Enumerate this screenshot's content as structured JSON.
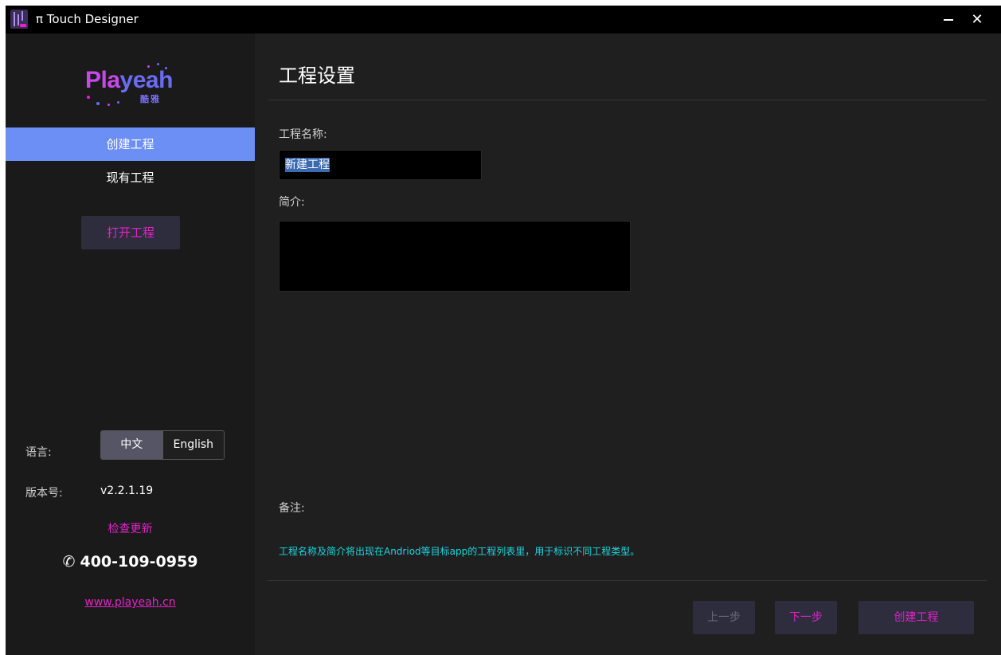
{
  "window": {
    "title": "π Touch Designer",
    "minimize_label": "minimize",
    "close_glyph": "✕"
  },
  "sidebar": {
    "logo": {
      "word_a": "Pla",
      "word_b": "yeah",
      "sub": "酷雅"
    },
    "nav": [
      {
        "label": "创建工程",
        "active": true
      },
      {
        "label": "现有工程",
        "active": false
      }
    ],
    "open_project_label": "打开工程",
    "language": {
      "label": "语言:",
      "options": [
        "中文",
        "English"
      ],
      "selected": "中文"
    },
    "version": {
      "label": "版本号:",
      "value": "v2.2.1.19"
    },
    "check_update_label": "检查更新",
    "phone": {
      "icon": "phone-icon",
      "glyph": "✆",
      "number": "400-109-0959"
    },
    "website": "www.playeah.cn"
  },
  "main": {
    "title": "工程设置",
    "name_label": "工程名称:",
    "name_value": "新建工程",
    "desc_label": "简介:",
    "desc_value": "",
    "note_label": "备注:",
    "note_text": "工程名称及简介将出现在Andriod等目标app的工程列表里，用于标识不同工程类型。",
    "buttons": {
      "prev": "上一步",
      "next": "下一步",
      "create": "创建工程"
    }
  },
  "colors": {
    "accent": "#e024c8",
    "nav_active": "#6b8ff5",
    "note": "#1fd6e0",
    "button_bg": "#2d2d3d"
  }
}
